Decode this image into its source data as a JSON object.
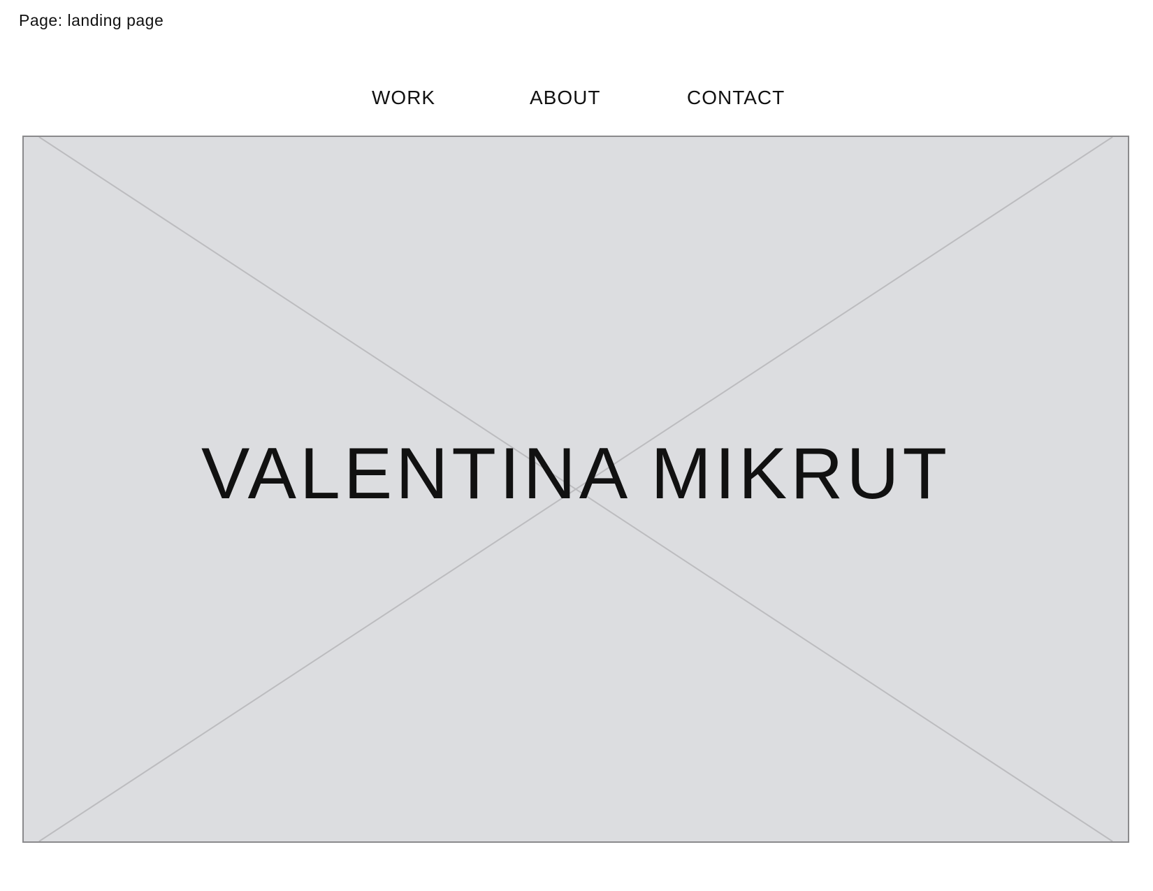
{
  "page_label": "Page: landing page",
  "nav": {
    "items": [
      {
        "label": "WORK"
      },
      {
        "label": "ABOUT"
      },
      {
        "label": "CONTACT"
      }
    ]
  },
  "hero": {
    "title": "VALENTINA MIKRUT",
    "image": "image-placeholder",
    "background_color": "#dcdde0",
    "border_color": "#8a8a8c",
    "cross_line_color": "#bcbcbf"
  }
}
